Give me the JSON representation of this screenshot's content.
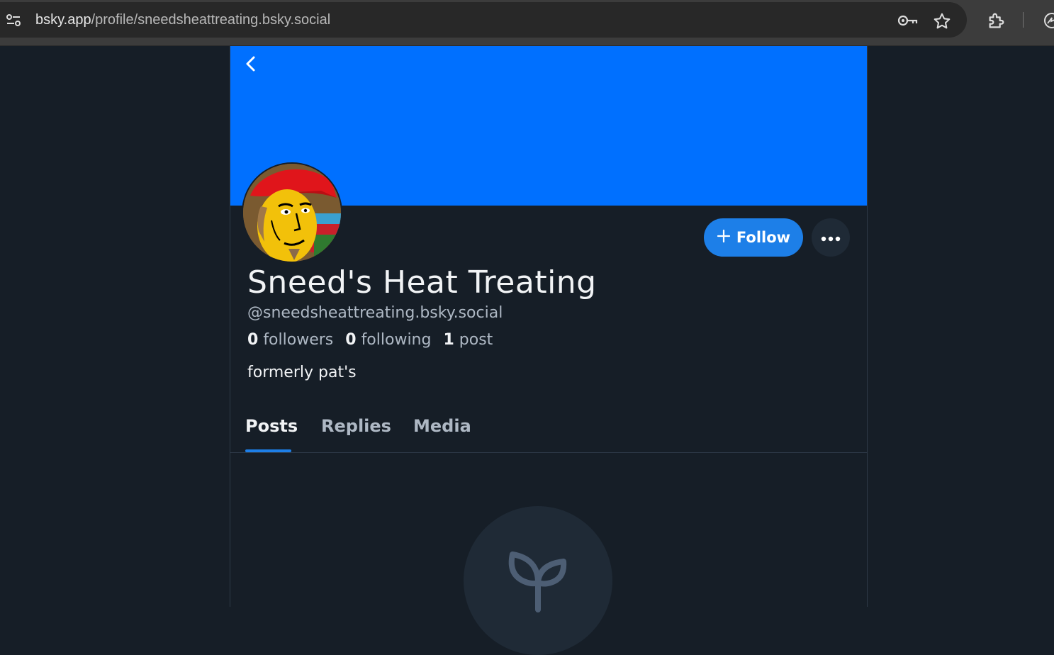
{
  "browser": {
    "url_host": "bsky.app",
    "url_path": "/profile/sneedsheattreating.bsky.social",
    "icons": [
      "site-info-icon",
      "password-key-icon",
      "bookmark-star-icon",
      "extensions-puzzle-icon",
      "profile-icon"
    ]
  },
  "colors": {
    "banner": "#0070ff",
    "accent": "#1d7fe8",
    "background": "#161e27"
  },
  "profile": {
    "display_name": "Sneed's Heat Treating",
    "handle": "@sneedsheattreating.bsky.social",
    "followers_count": "0",
    "followers_label": "followers",
    "following_count": "0",
    "following_label": "following",
    "posts_count": "1",
    "posts_label": "post",
    "bio": "formerly pat's"
  },
  "actions": {
    "follow_label": "Follow"
  },
  "tabs": [
    {
      "label": "Posts",
      "active": true
    },
    {
      "label": "Replies",
      "active": false
    },
    {
      "label": "Media",
      "active": false
    }
  ]
}
